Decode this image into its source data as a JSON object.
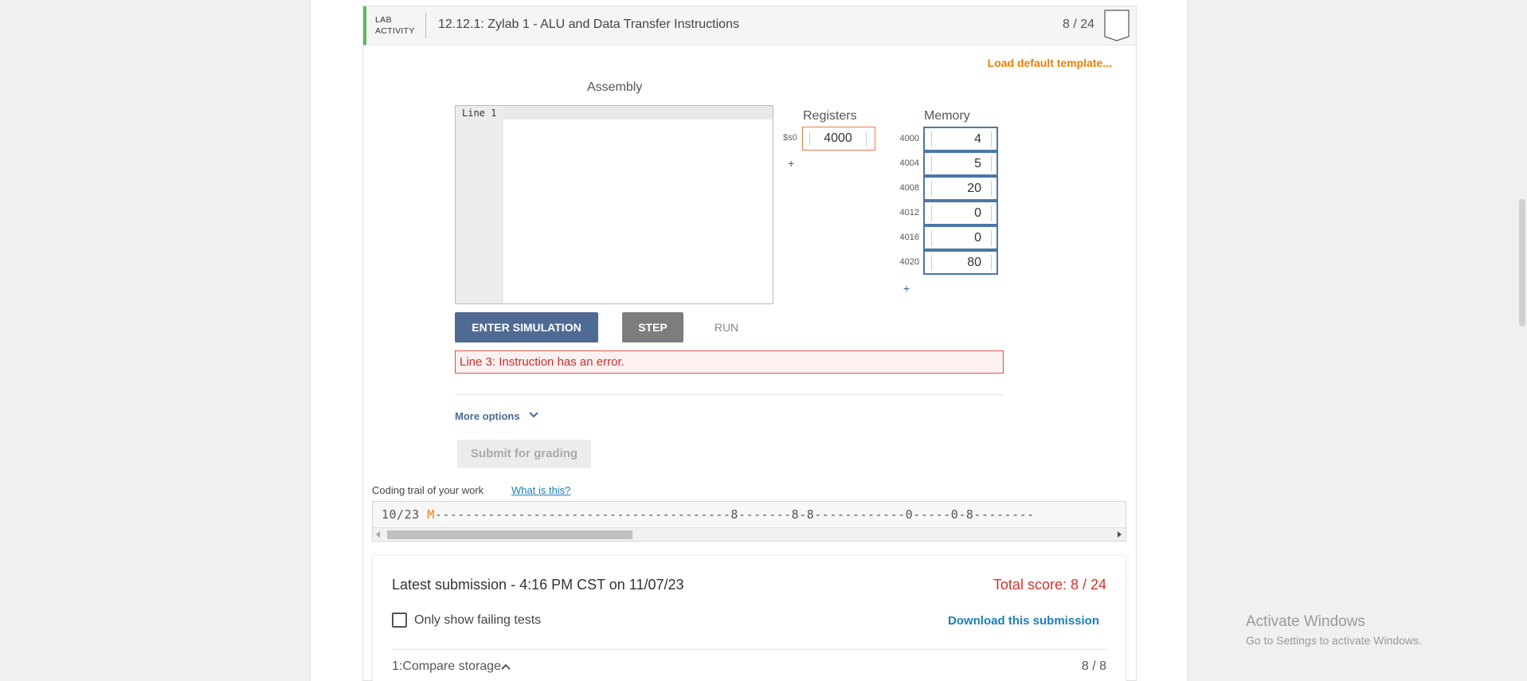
{
  "activity": {
    "type_line1": "LAB",
    "type_line2": "ACTIVITY",
    "title": "12.12.1: Zylab 1 - ALU and Data Transfer Instructions",
    "score": "8 / 24",
    "load_template": "Load default template...",
    "accent_color": "#5cb85c"
  },
  "editor": {
    "title": "Assembly",
    "line_label": "Line 1"
  },
  "registers": {
    "title": "Registers",
    "items": [
      {
        "name": "$s0",
        "value": "4000"
      }
    ],
    "add": "+"
  },
  "memory": {
    "title": "Memory",
    "cells": [
      {
        "address": "4000",
        "value": "4"
      },
      {
        "address": "4004",
        "value": "5"
      },
      {
        "address": "4008",
        "value": "20"
      },
      {
        "address": "4012",
        "value": "0"
      },
      {
        "address": "4016",
        "value": "0"
      },
      {
        "address": "4020",
        "value": "80"
      }
    ],
    "add": "+"
  },
  "controls": {
    "enter_simulation": "ENTER SIMULATION",
    "step": "STEP",
    "run": "RUN"
  },
  "error": {
    "message": "Line 3: Instruction has an error."
  },
  "options": {
    "more_options": "More options"
  },
  "submit": {
    "label": "Submit for grading"
  },
  "trail": {
    "label": "Coding trail of your work",
    "help": "What is this?",
    "prefix": "10/23",
    "marker": "M",
    "rest": "---------------------------------------8-------8-8------------0-----0-8--------"
  },
  "results": {
    "latest": "Latest submission - 4:16 PM CST on 11/07/23",
    "total": "Total score: 8 / 24",
    "only_failing": "Only show failing tests",
    "download": "Download this submission",
    "test_name": "1:Compare storage",
    "test_score": "8 / 8"
  },
  "watermark": {
    "line1": "Activate Windows",
    "line2": "Go to Settings to activate Windows."
  }
}
